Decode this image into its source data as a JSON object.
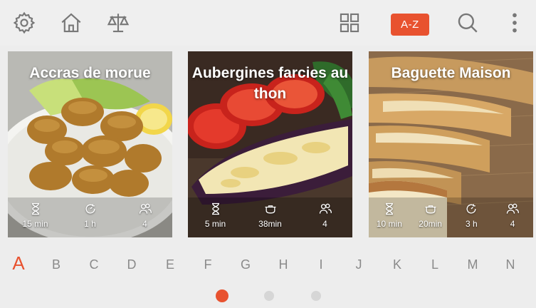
{
  "toolbar": {
    "settings_icon": "gear-icon",
    "home_icon": "home-icon",
    "scale_icon": "balance-scale-icon",
    "grid_icon": "grid-view-icon",
    "az_label": "A-Z",
    "search_icon": "search-icon",
    "menu_icon": "more-vert-icon"
  },
  "colors": {
    "accent": "#e8522f",
    "background": "#ededed",
    "inactive": "#8a8a8a"
  },
  "recipes": [
    {
      "title": "Accras de morue",
      "stats": [
        {
          "icon": "hourglass-icon",
          "value": "15 min"
        },
        {
          "icon": "cook-time-icon",
          "value": "1 h"
        },
        {
          "icon": "servings-icon",
          "value": "4"
        }
      ]
    },
    {
      "title": "Aubergines farcies au thon",
      "stats": [
        {
          "icon": "hourglass-icon",
          "value": "5 min"
        },
        {
          "icon": "pot-icon",
          "value": "38min"
        },
        {
          "icon": "servings-icon",
          "value": "4"
        }
      ]
    },
    {
      "title": "Baguette Maison",
      "stats": [
        {
          "icon": "hourglass-icon",
          "value": "10 min"
        },
        {
          "icon": "pot-icon",
          "value": "20min"
        },
        {
          "icon": "cook-time-icon",
          "value": "3 h"
        },
        {
          "icon": "servings-icon",
          "value": "4"
        }
      ]
    }
  ],
  "alphabet": {
    "letters": [
      "A",
      "B",
      "C",
      "D",
      "E",
      "F",
      "G",
      "H",
      "I",
      "J",
      "K",
      "L",
      "M",
      "N"
    ],
    "selected": "A"
  },
  "pagination": {
    "pages": 3,
    "current": 1
  }
}
